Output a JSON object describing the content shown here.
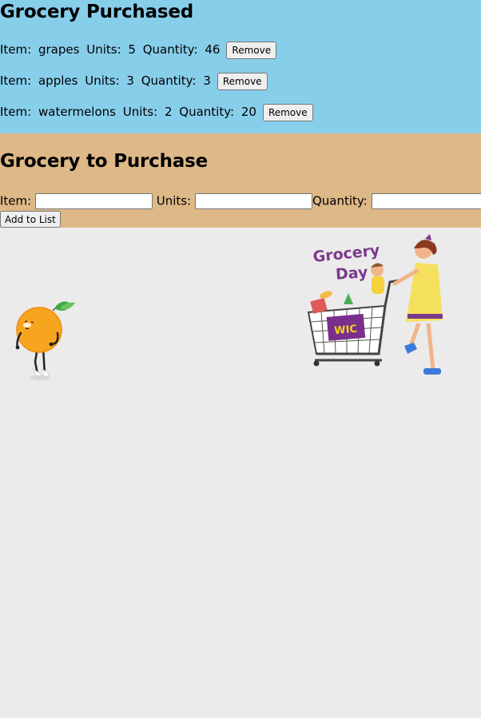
{
  "purchased": {
    "title": "Grocery Purchased",
    "items": [
      {
        "item": "grapes",
        "units": "5",
        "quantity": "46"
      },
      {
        "item": "apples",
        "units": "3",
        "quantity": "3"
      },
      {
        "item": "watermelons",
        "units": "2",
        "quantity": "20"
      }
    ],
    "remove_label": "Remove",
    "item_label": "Item:",
    "units_label": "Units:",
    "quantity_label": "Quantity:"
  },
  "to_purchase": {
    "title": "Grocery to Purchase",
    "item_label": "Item:",
    "units_label": "Units:",
    "quantity_label": "Quantity:",
    "item_value": "",
    "units_value": "",
    "quantity_value": "",
    "add_label": "Add to List"
  },
  "illustration": {
    "badge_text": "Grocery\nDay",
    "bag_text": "WIC"
  },
  "colors": {
    "purchased_bg": "#87ceeb",
    "to_purchase_bg": "#deb887",
    "page_bg": "#ebebeb"
  }
}
